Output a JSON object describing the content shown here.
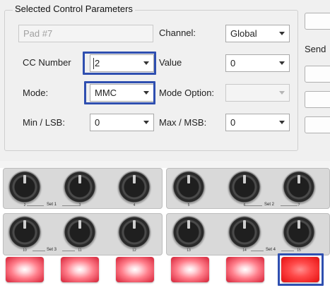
{
  "group_title": "Selected Control Parameters",
  "pad_name": {
    "value": "Pad #7"
  },
  "labels": {
    "channel": "Channel:",
    "cc_number": "CC Number",
    "value": "Value",
    "mode": "Mode:",
    "mode_option": "Mode Option:",
    "min_lsb": "Min / LSB:",
    "max_msb": "Max / MSB:"
  },
  "fields": {
    "channel": "Global",
    "cc_number": "2",
    "value": "0",
    "mode": "MMC",
    "mode_option": "",
    "min_lsb": "0",
    "max_msb": "0"
  },
  "right_panel": {
    "send_label": "Send"
  },
  "highlight_color": "#2f4fb0",
  "controller": {
    "top_row": {
      "knob_labels": [
        "2",
        "3",
        "4",
        "5",
        "6",
        "7"
      ]
    },
    "bottom_row": {
      "knob_labels": [
        "10",
        "11",
        "12",
        "13",
        "14",
        "15"
      ]
    },
    "set_labels": [
      "Set 1",
      "Set 2",
      "Set 3",
      "Set 4"
    ],
    "pads": 6,
    "selected_pad": 6
  }
}
